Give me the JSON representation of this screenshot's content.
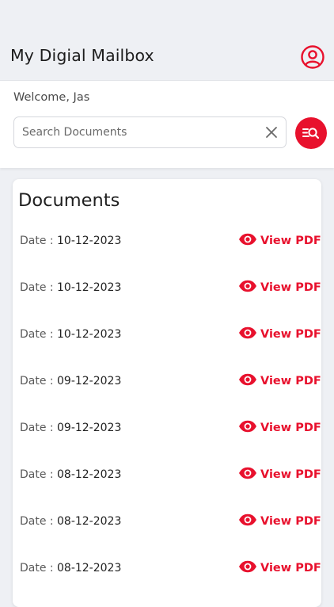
{
  "header": {
    "title": "My Digial Mailbox",
    "profile_icon": "user-circle-icon"
  },
  "welcome": {
    "text": "Welcome, Jas"
  },
  "search": {
    "placeholder": "Search Documents",
    "value": "",
    "clear_icon": "close-icon",
    "button_icon": "search-list-icon"
  },
  "documents": {
    "title": "Documents",
    "date_label": "Date :",
    "view_label": "View PDF",
    "view_icon": "eye-icon",
    "rows": [
      {
        "date": "10-12-2023"
      },
      {
        "date": "10-12-2023"
      },
      {
        "date": "10-12-2023"
      },
      {
        "date": "09-12-2023"
      },
      {
        "date": "09-12-2023"
      },
      {
        "date": "08-12-2023"
      },
      {
        "date": "08-12-2023"
      },
      {
        "date": "08-12-2023"
      }
    ]
  },
  "colors": {
    "accent": "#e8112d",
    "background": "#eef0f4",
    "card": "#ffffff",
    "text": "#1f1f1f"
  }
}
